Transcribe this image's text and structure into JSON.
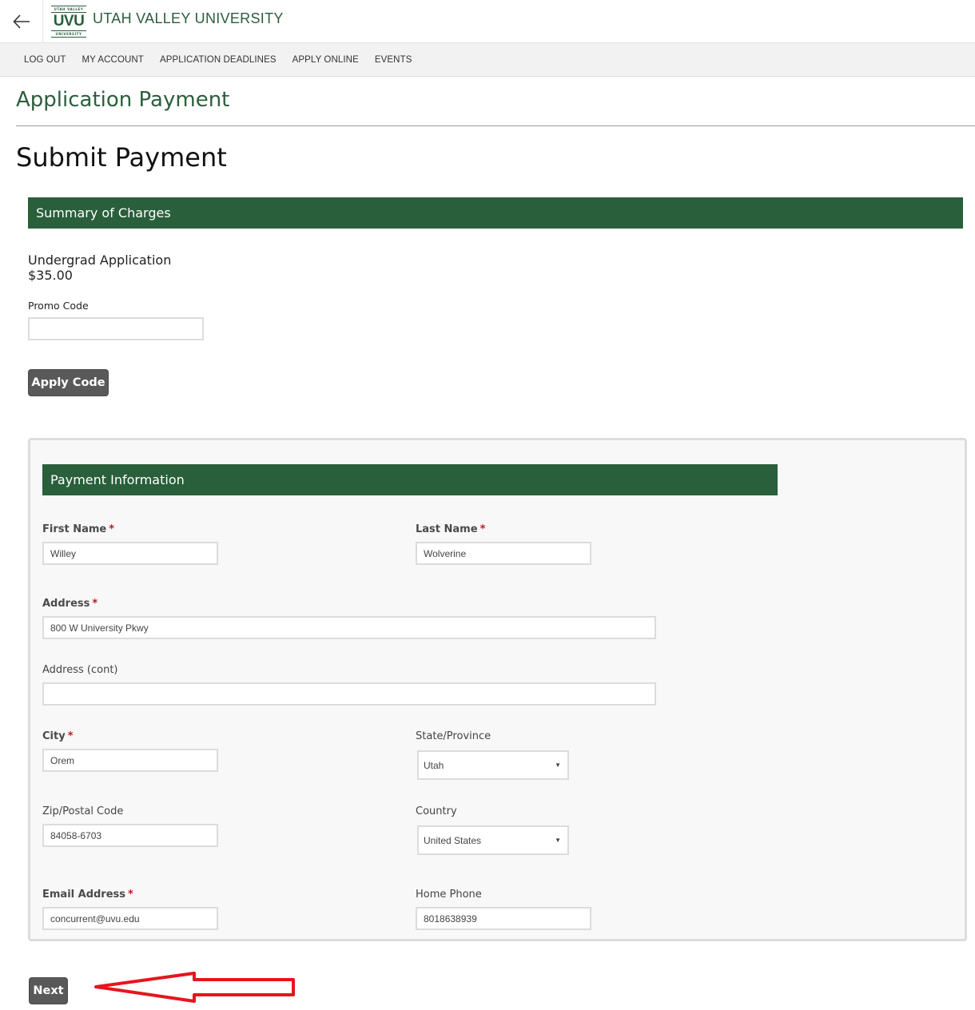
{
  "header": {
    "back_icon": "arrow-left-icon",
    "logo": {
      "top": "UTAH VALLEY",
      "main": "UVU",
      "bottom": "UNIVERSITY"
    },
    "brand": "UTAH VALLEY UNIVERSITY"
  },
  "nav": {
    "items": [
      {
        "label": "LOG OUT"
      },
      {
        "label": "MY ACCOUNT"
      },
      {
        "label": "APPLICATION DEADLINES"
      },
      {
        "label": "APPLY ONLINE"
      },
      {
        "label": "EVENTS"
      }
    ]
  },
  "page": {
    "title": "Application Payment",
    "section": "Submit Payment"
  },
  "summary": {
    "heading": "Summary of Charges",
    "item_name": "Undergrad Application",
    "item_amount": "$35.00",
    "promo_label": "Promo Code",
    "promo_value": "",
    "apply_button": "Apply Code"
  },
  "payment": {
    "heading": "Payment Information",
    "required_marker": "*",
    "fields": {
      "first_name": {
        "label": "First Name",
        "value": "Willey"
      },
      "last_name": {
        "label": "Last Name",
        "value": "Wolverine"
      },
      "address": {
        "label": "Address",
        "value": "800 W University Pkwy"
      },
      "address_cont": {
        "label": "Address (cont)",
        "value": ""
      },
      "city": {
        "label": "City",
        "value": "Orem"
      },
      "state": {
        "label": "State/Province",
        "value": "Utah"
      },
      "zip": {
        "label": "Zip/Postal Code",
        "value": "84058-6703"
      },
      "country": {
        "label": "Country",
        "value": "United States"
      },
      "email": {
        "label": "Email Address",
        "value": "concurrent@uvu.edu"
      },
      "phone": {
        "label": "Home Phone",
        "value": "8018638939"
      }
    }
  },
  "footer": {
    "next_button": "Next",
    "annotation_color": "#e8141e"
  },
  "colors": {
    "brand_green": "#295f3b",
    "button_gray": "#595959",
    "required_red": "#c0181f"
  }
}
